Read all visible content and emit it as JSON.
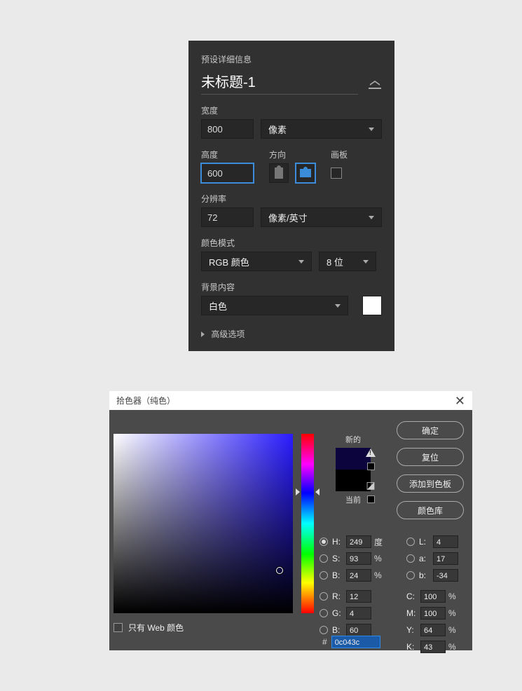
{
  "preset": {
    "header": "预设详细信息",
    "title": "未标题-1",
    "width_label": "宽度",
    "width_value": "800",
    "width_unit": "像素",
    "height_label": "高度",
    "height_value": "600",
    "orient_label": "方向",
    "artboard_label": "画板",
    "resolution_label": "分辨率",
    "resolution_value": "72",
    "resolution_unit": "像素/英寸",
    "color_mode_label": "颜色模式",
    "color_mode_value": "RGB 颜色",
    "bit_depth_value": "8 位",
    "bg_label": "背景内容",
    "bg_value": "白色",
    "bg_swatch_color": "#ffffff",
    "advanced_label": "高级选项"
  },
  "picker": {
    "title": "拾色器（纯色）",
    "new_label": "新的",
    "current_label": "当前",
    "new_color": "#0c043c",
    "current_color": "#000000",
    "buttons": {
      "ok": "确定",
      "reset": "复位",
      "add_swatch": "添加到色板",
      "color_lib": "颜色库"
    },
    "fields": {
      "h_label": "H:",
      "h": "249",
      "h_unit": "度",
      "s_label": "S:",
      "s": "93",
      "s_unit": "%",
      "bHSB_label": "B:",
      "bHSB": "24",
      "bHSB_unit": "%",
      "r_label": "R:",
      "r": "12",
      "g_label": "G:",
      "g": "4",
      "bRGB_label": "B:",
      "bRGB": "60",
      "l_label": "L:",
      "l": "4",
      "a_label": "a:",
      "a": "17",
      "lab_b_label": "b:",
      "lab_b": "-34",
      "c_label": "C:",
      "c": "100",
      "c_unit": "%",
      "m_label": "M:",
      "m": "100",
      "m_unit": "%",
      "y_label": "Y:",
      "y": "64",
      "y_unit": "%",
      "k_label": "K:",
      "k": "43",
      "k_unit": "%",
      "hex_prefix": "#",
      "hex": "0c043c"
    },
    "web_only_label": "只有 Web 颜色"
  }
}
